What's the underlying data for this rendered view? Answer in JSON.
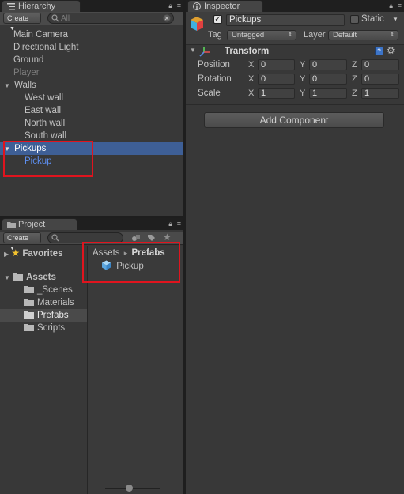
{
  "hierarchy": {
    "tab_label": "Hierarchy",
    "create_label": "Create",
    "search_placeholder": "All",
    "items": [
      {
        "label": "Main Camera",
        "color": "#c2c2c2"
      },
      {
        "label": "Directional Light",
        "color": "#c2c2c2"
      },
      {
        "label": "Ground",
        "color": "#c2c2c2"
      },
      {
        "label": "Player",
        "color": "#7d7d7d"
      },
      {
        "label": "Walls",
        "color": "#c2c2c2"
      },
      {
        "label": "West wall",
        "color": "#c2c2c2"
      },
      {
        "label": "East wall",
        "color": "#c2c2c2"
      },
      {
        "label": "North wall",
        "color": "#c2c2c2"
      },
      {
        "label": "South wall",
        "color": "#c2c2c2"
      },
      {
        "label": "Pickups",
        "color": "#ffffff"
      },
      {
        "label": "Pickup",
        "color": "#5d8ff0"
      }
    ],
    "selected_bg": "#3e5f96"
  },
  "inspector": {
    "tab_label": "Inspector",
    "object_name": "Pickups",
    "static_label": "Static",
    "tag_label": "Tag",
    "tag_value": "Untagged",
    "layer_label": "Layer",
    "layer_value": "Default",
    "transform": {
      "title": "Transform",
      "rows": [
        {
          "label": "Position",
          "x": "0",
          "y": "0",
          "z": "0"
        },
        {
          "label": "Rotation",
          "x": "0",
          "y": "0",
          "z": "0"
        },
        {
          "label": "Scale",
          "x": "1",
          "y": "1",
          "z": "1"
        }
      ],
      "axis_labels": [
        "X",
        "Y",
        "Z"
      ]
    },
    "add_component_label": "Add Component"
  },
  "project": {
    "tab_label": "Project",
    "create_label": "Create",
    "favorites_label": "Favorites",
    "assets_label": "Assets",
    "folders": [
      "_Scenes",
      "Materials",
      "Prefabs",
      "Scripts"
    ],
    "breadcrumb": {
      "root": "Assets",
      "sep": "▸",
      "current": "Prefabs"
    },
    "asset_items": [
      "Pickup"
    ]
  },
  "colors": {
    "highlight_red": "#e0141e",
    "prefab_blue": "#5d8ff0"
  }
}
